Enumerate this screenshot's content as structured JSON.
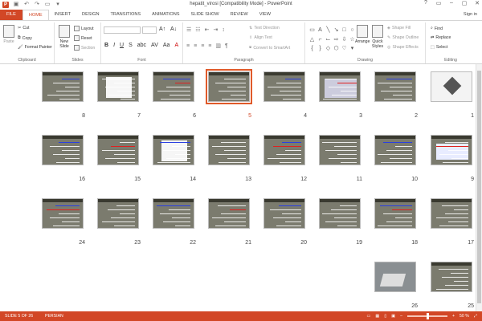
{
  "window": {
    "title": "hepatit_virosi [Compatibility Mode] - PowerPoint",
    "controls": [
      "?",
      "▭",
      "–",
      "▢",
      "✕"
    ]
  },
  "tabs": [
    {
      "label": "FILE"
    },
    {
      "label": "HOME"
    },
    {
      "label": "INSERT"
    },
    {
      "label": "DESIGN"
    },
    {
      "label": "TRANSITIONS"
    },
    {
      "label": "ANIMATIONS"
    },
    {
      "label": "SLIDE SHOW"
    },
    {
      "label": "REVIEW"
    },
    {
      "label": "VIEW"
    }
  ],
  "signin": "Sign in",
  "ribbon": {
    "clipboard": {
      "label": "Clipboard",
      "paste": "Paste",
      "cut": "Cut",
      "copy": "Copy",
      "format_painter": "Format Painter"
    },
    "slides": {
      "label": "Slides",
      "new_slide": "New Slide",
      "layout": "Layout",
      "reset": "Reset",
      "section": "Section"
    },
    "font": {
      "label": "Font"
    },
    "paragraph": {
      "label": "Paragraph",
      "text_direction": "Text Direction",
      "align_text": "Align Text",
      "convert": "Convert to SmartArt"
    },
    "drawing": {
      "label": "Drawing",
      "arrange": "Arrange",
      "quick_styles": "Quick Styles",
      "shape_fill": "Shape Fill",
      "shape_outline": "Shape Outline",
      "shape_effects": "Shape Effects"
    },
    "editing": {
      "label": "Editing",
      "find": "Find",
      "replace": "Replace",
      "select": "Select"
    }
  },
  "slides": [
    {
      "num": "8"
    },
    {
      "num": "7"
    },
    {
      "num": "6"
    },
    {
      "num": "5"
    },
    {
      "num": "4"
    },
    {
      "num": "3"
    },
    {
      "num": "2"
    },
    {
      "num": "1"
    },
    {
      "num": "16"
    },
    {
      "num": "15"
    },
    {
      "num": "14"
    },
    {
      "num": "13"
    },
    {
      "num": "12"
    },
    {
      "num": "11"
    },
    {
      "num": "10"
    },
    {
      "num": "9"
    },
    {
      "num": "24"
    },
    {
      "num": "23"
    },
    {
      "num": "22"
    },
    {
      "num": "21"
    },
    {
      "num": "20"
    },
    {
      "num": "19"
    },
    {
      "num": "18"
    },
    {
      "num": "17"
    },
    {
      "num": "26"
    },
    {
      "num": "25"
    }
  ],
  "selected_slide": "5",
  "status": {
    "slide_of": "SLIDE 5 OF 26",
    "language": "PERSIAN",
    "zoom": "50 %"
  },
  "colors": {
    "accent": "#d24726"
  }
}
